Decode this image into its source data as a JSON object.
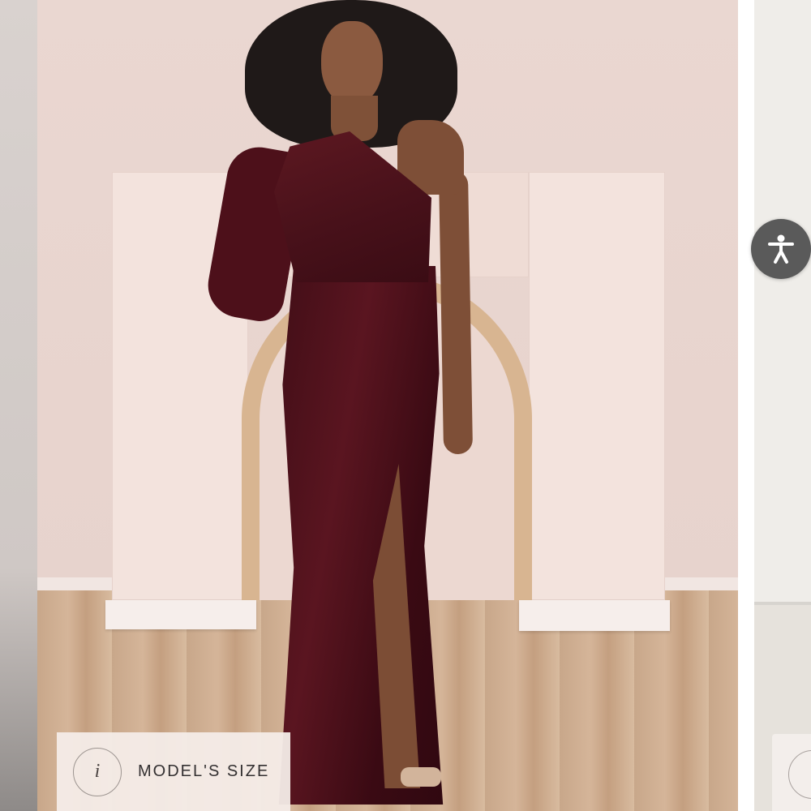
{
  "gallery": {
    "main_image": {
      "alt_semantic": "model-in-burgundy-velvet-one-shoulder-gown"
    },
    "size_chip": {
      "icon": "info-icon",
      "icon_glyph": "i",
      "label": "MODEL'S SIZE"
    },
    "next_slide_chip": {
      "icon": "info-icon"
    }
  },
  "accessibility": {
    "icon": "accessibility-icon",
    "color": "#5a5a5a"
  },
  "colors": {
    "dress": "#4d101a",
    "wall": "#ead7d1",
    "arch": "#d8b591"
  }
}
